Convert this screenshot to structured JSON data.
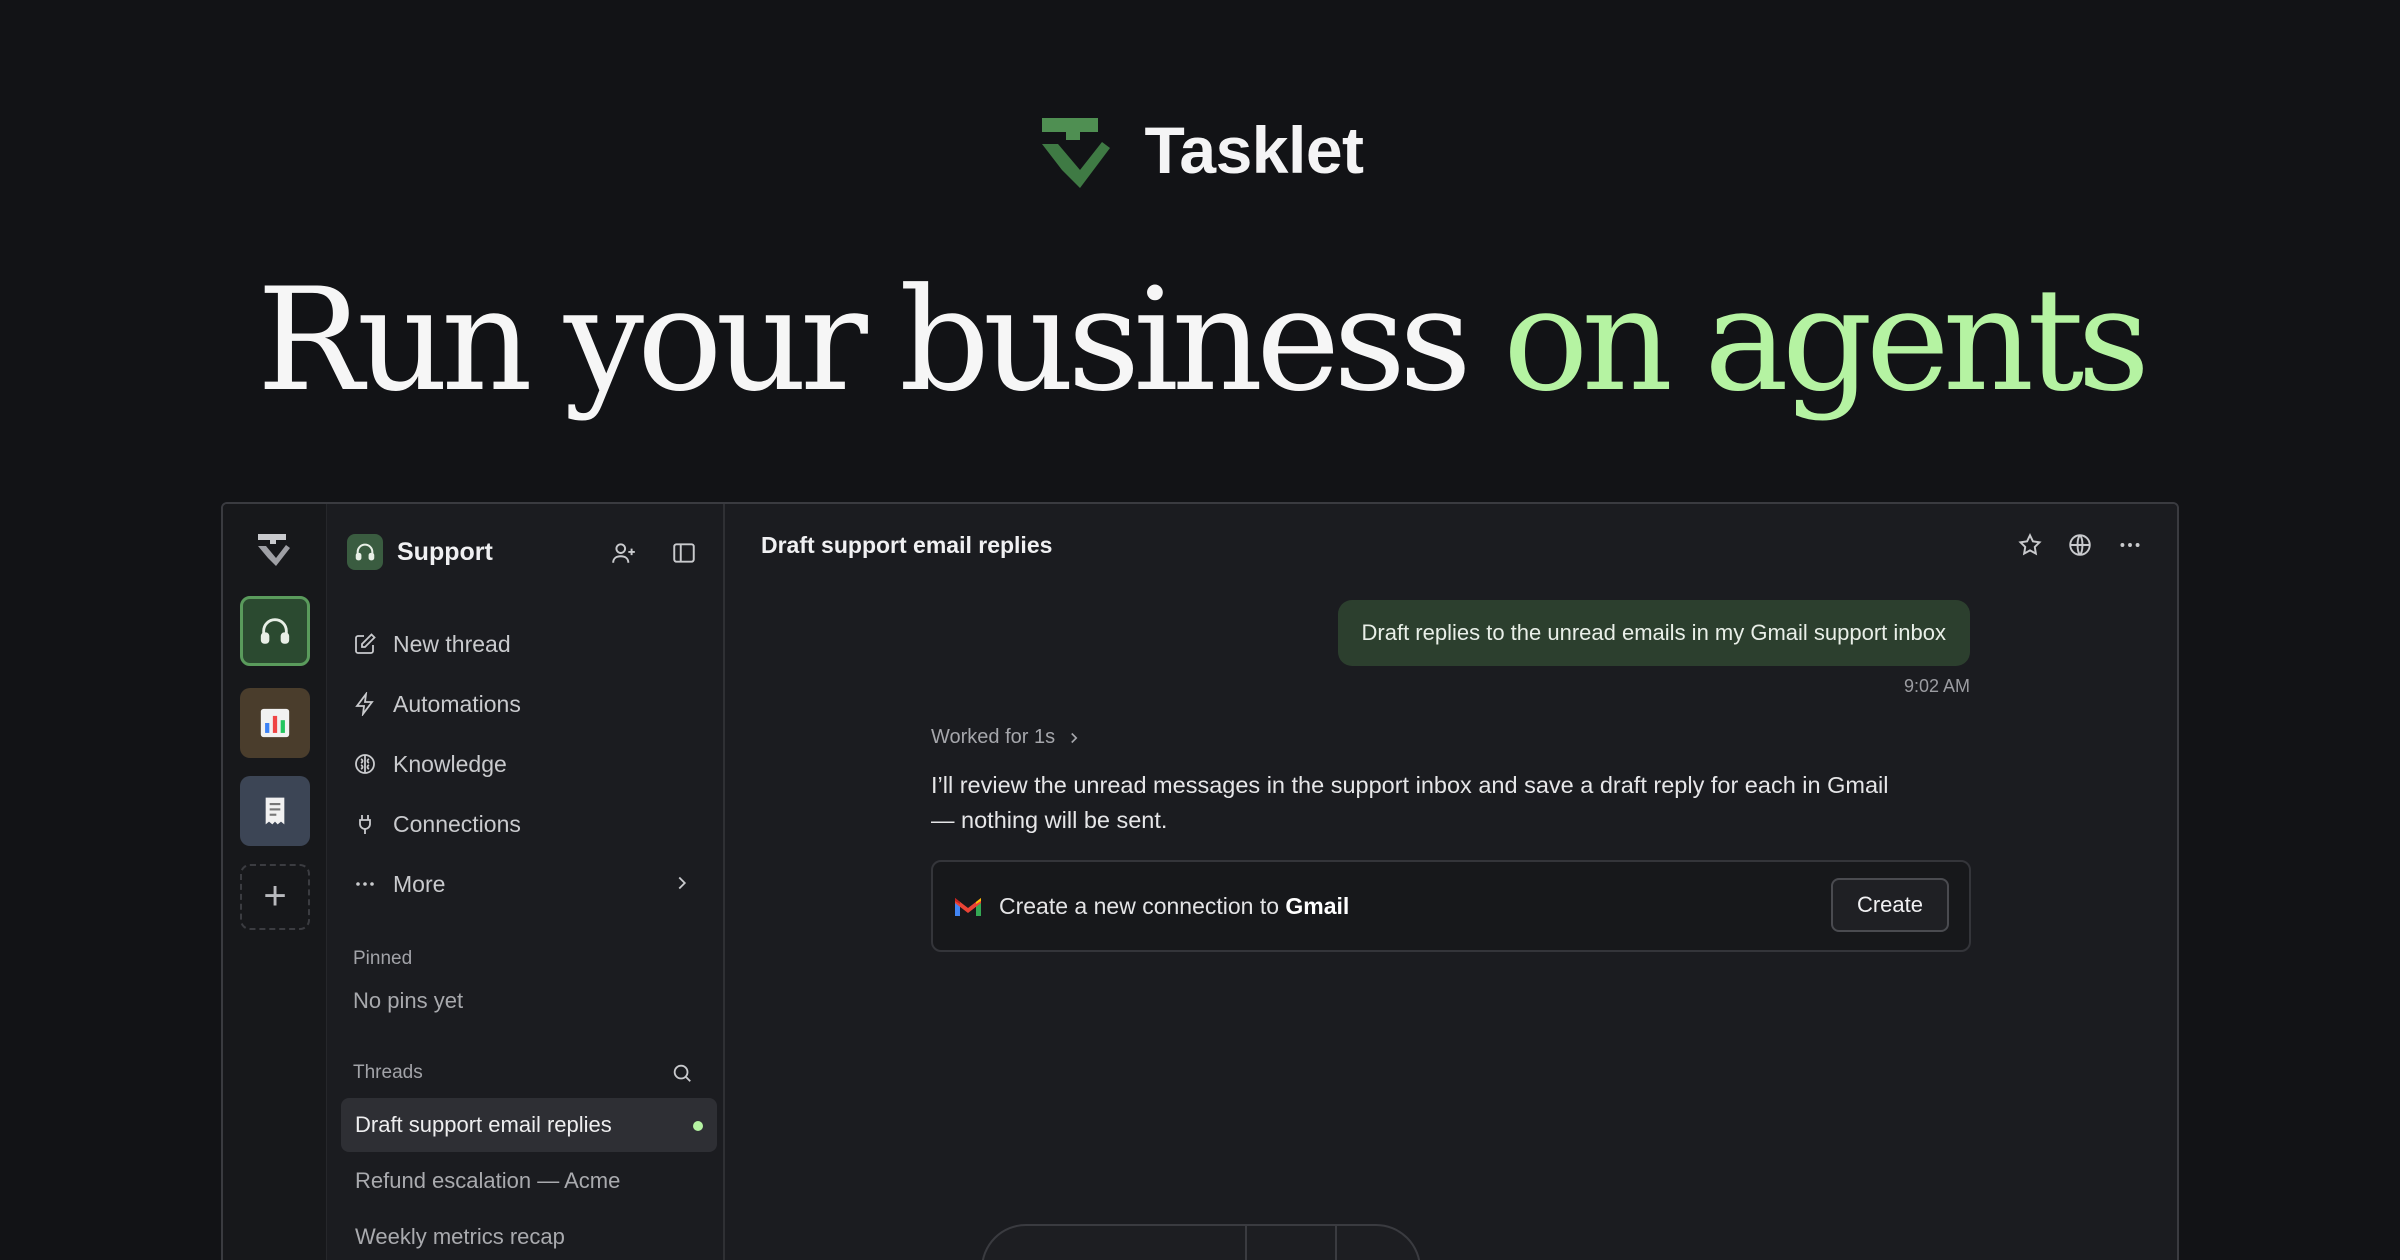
{
  "brand": {
    "name": "Tasklet"
  },
  "hero": {
    "headline_main": "Run your business ",
    "headline_accent": "on agents"
  },
  "colors": {
    "accent": "#b5f3a2",
    "brand_green": "#4f8f52",
    "background": "#121316"
  },
  "rail": {
    "workspaces": [
      {
        "name": "headphones-icon",
        "active": true
      },
      {
        "name": "bar-chart-icon",
        "active": false
      },
      {
        "name": "receipt-icon",
        "active": false
      }
    ],
    "add_icon": "+"
  },
  "sidebar": {
    "workspace_title": "Support",
    "nav": [
      {
        "label": "New thread",
        "icon": "edit-icon"
      },
      {
        "label": "Automations",
        "icon": "bolt-icon"
      },
      {
        "label": "Knowledge",
        "icon": "brain-icon"
      },
      {
        "label": "Connections",
        "icon": "plug-icon"
      },
      {
        "label": "More",
        "icon": "more-icon"
      }
    ],
    "pinned_label": "Pinned",
    "pinned_empty": "No pins yet",
    "threads_label": "Threads",
    "threads": [
      {
        "label": "Draft support email replies",
        "active": true
      },
      {
        "label": "Refund escalation — Acme",
        "active": false
      },
      {
        "label": "Weekly metrics recap",
        "active": false
      }
    ]
  },
  "main": {
    "title": "Draft support email replies",
    "user_message": "Draft replies to the unread emails in my Gmail support inbox",
    "time": "9:02 AM",
    "worked": "Worked for 1s",
    "reply_line1": "I’ll review the unread messages in the support inbox and save a draft reply for each in Gmail",
    "reply_line2": "— nothing will be sent.",
    "connection": {
      "prefix": "Create a new connection to ",
      "service": "Gmail",
      "button": "Create"
    }
  }
}
